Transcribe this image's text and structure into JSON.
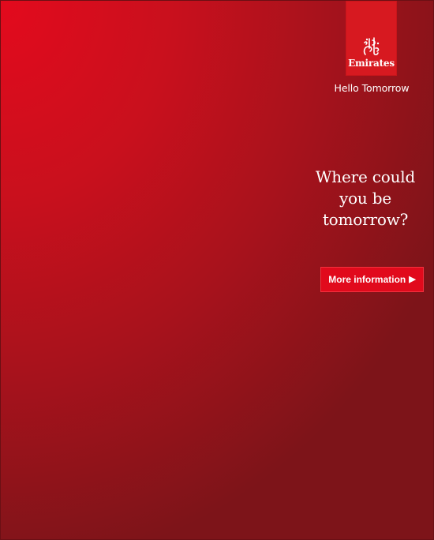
{
  "brand": {
    "wordmark": "Emirates",
    "tagline": "Hello Tomorrow",
    "logo_color": "#d71920",
    "emblem_icon": "emirates-calligraphy-emblem-icon"
  },
  "headline": {
    "lines": [
      "Where could",
      "you be",
      "tomorrow?"
    ]
  },
  "cta": {
    "label": "More information",
    "arrow_icon": "play-arrow-icon",
    "arrow_glyph": "▶",
    "color": "#e10a1c"
  },
  "background": {
    "color_start": "#e30a1d",
    "color_end": "#7d1419"
  }
}
